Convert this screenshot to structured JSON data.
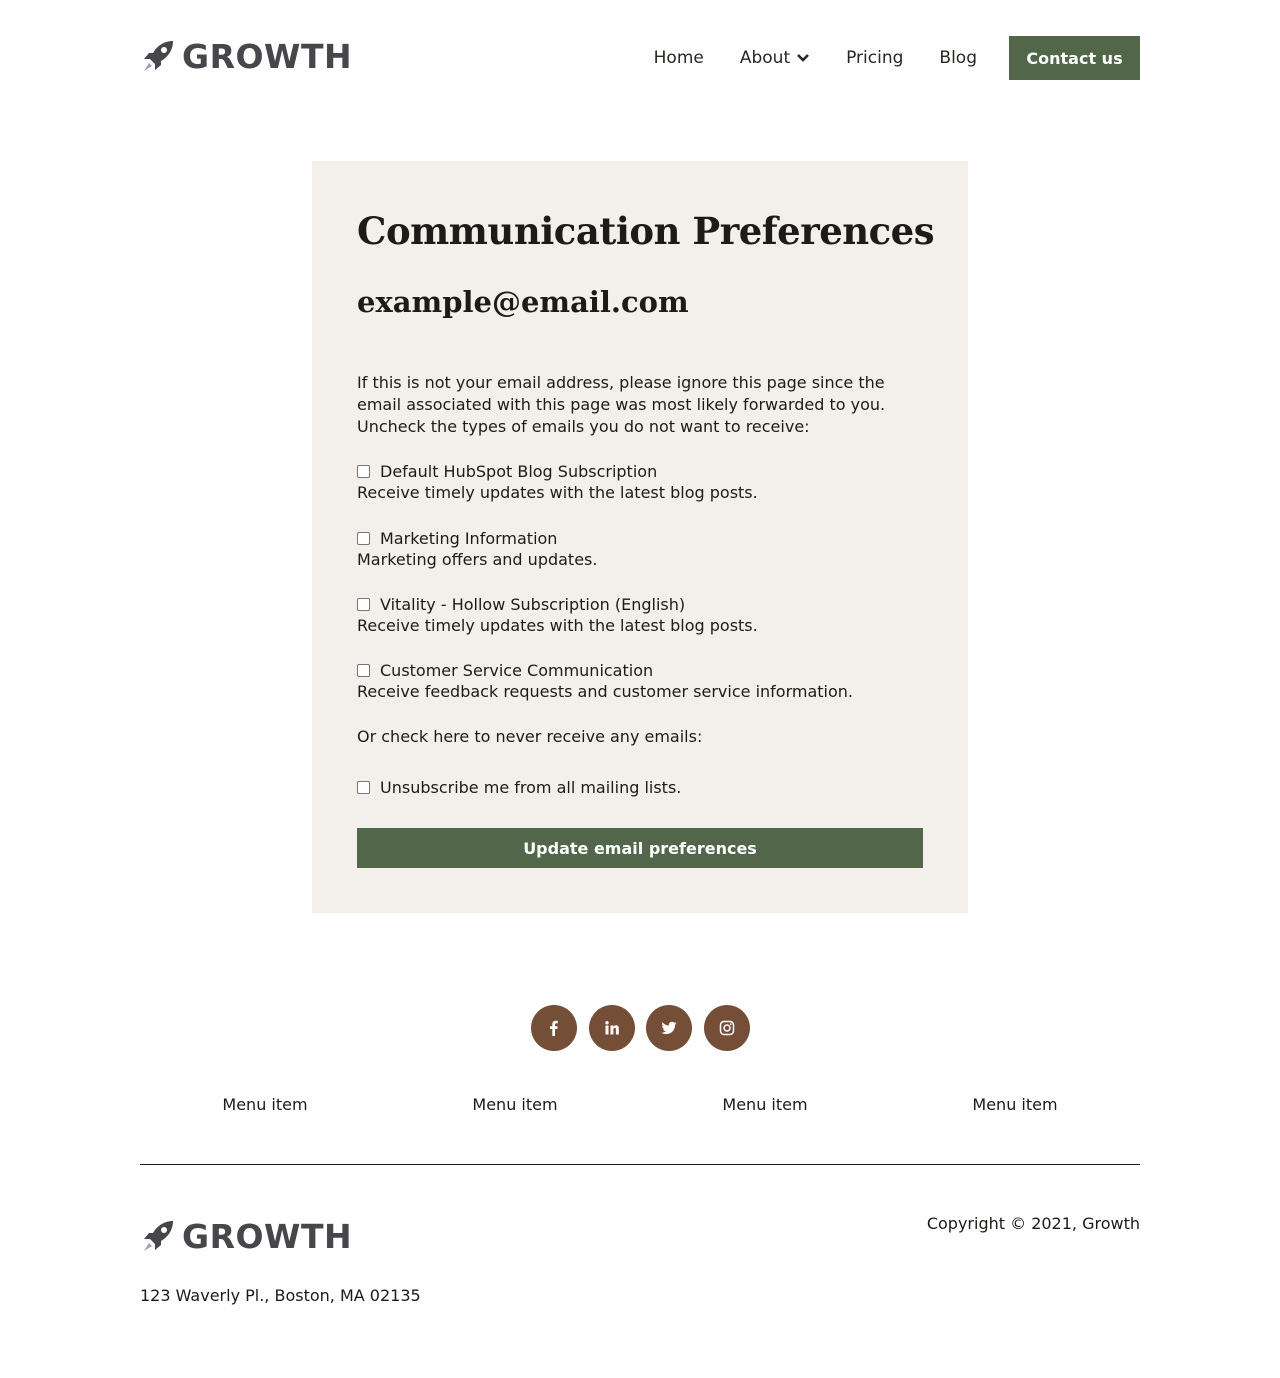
{
  "header": {
    "logo_text": "GROWTH",
    "nav": [
      "Home",
      "About",
      "Pricing",
      "Blog"
    ],
    "contact_label": "Contact us"
  },
  "card": {
    "title": "Communication Preferences",
    "email": "example@email.com",
    "intro": "If this is not your email address, please ignore this page since the email associated with this page was most likely forwarded to you. Uncheck the types of emails you do not want to receive:",
    "subscriptions": [
      {
        "name": "Default HubSpot Blog Subscription",
        "description": "Receive timely updates with the latest blog posts."
      },
      {
        "name": "Marketing Information",
        "description": "Marketing offers and updates."
      },
      {
        "name": "Vitality - Hollow Subscription (English)",
        "description": "Receive timely updates with the latest blog posts."
      },
      {
        "name": "Customer Service Communication",
        "description": "Receive feedback requests and customer service information."
      }
    ],
    "or_text": "Or check here to never receive any emails:",
    "unsubscribe_label": "Unsubscribe me from all mailing lists.",
    "update_button": "Update email preferences"
  },
  "social": [
    "facebook-icon",
    "linkedin-icon",
    "twitter-icon",
    "instagram-icon"
  ],
  "footer": {
    "menu": [
      "Menu item",
      "Menu item",
      "Menu item",
      "Menu item"
    ],
    "logo_text": "GROWTH",
    "copyright": "Copyright © 2021, Growth",
    "address": "123 Waverly Pl., Boston, MA 02135"
  },
  "colors": {
    "accent": "#526749",
    "social": "#744e37",
    "card_bg": "#f3f0ec",
    "logo": "#47464b"
  }
}
